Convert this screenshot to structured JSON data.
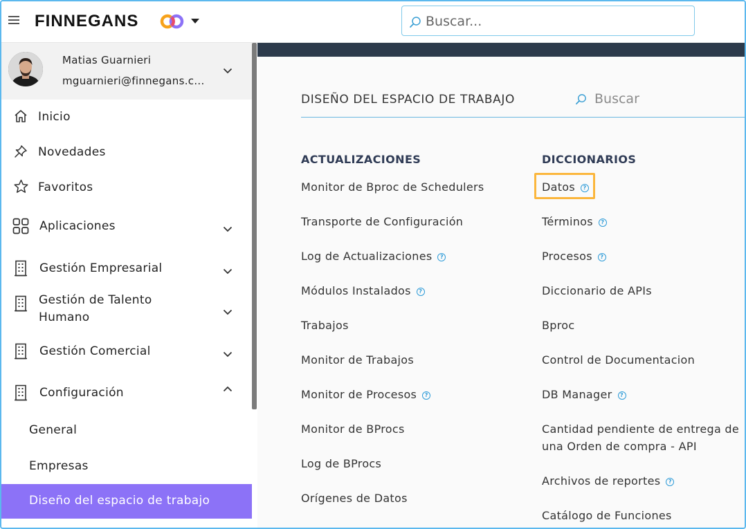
{
  "topbar": {
    "brand": "FINNEGANS",
    "search_placeholder": "Buscar..."
  },
  "profile": {
    "name": "Matias Guarnieri",
    "email": "mguarnieri@finnegans.c..."
  },
  "sidebar": {
    "items": [
      {
        "label": "Inicio",
        "icon": "home-icon"
      },
      {
        "label": "Novedades",
        "icon": "pin-icon"
      },
      {
        "label": "Favoritos",
        "icon": "star-icon"
      },
      {
        "label": "Aplicaciones",
        "icon": "apps-grid-icon"
      },
      {
        "label": "Gestión Empresarial",
        "icon": "building-icon"
      },
      {
        "label": "Gestión de Talento",
        "label2": "Humano",
        "icon": "building-icon"
      },
      {
        "label": "Gestión Comercial",
        "icon": "building-icon"
      },
      {
        "label": "Configuración",
        "icon": "building-icon"
      }
    ],
    "sub_items": [
      "General",
      "Empresas",
      "Diseño del espacio de trabajo"
    ]
  },
  "main": {
    "title": "DISEÑO DEL ESPACIO DE TRABAJO",
    "search_placeholder": "Buscar",
    "columns": [
      {
        "heading": "ACTUALIZACIONES",
        "links": [
          {
            "label": "Monitor de Bproc de Schedulers",
            "help": false
          },
          {
            "label": "Transporte de Configuración",
            "help": false
          },
          {
            "label": "Log de Actualizaciones",
            "help": true
          },
          {
            "label": "Módulos Instalados",
            "help": true
          },
          {
            "label": "Trabajos",
            "help": false
          },
          {
            "label": "Monitor de Trabajos",
            "help": false
          },
          {
            "label": "Monitor de Procesos",
            "help": true
          },
          {
            "label": "Monitor de BProcs",
            "help": false
          },
          {
            "label": "Log de BProcs",
            "help": false
          },
          {
            "label": "Orígenes de Datos",
            "help": false
          }
        ]
      },
      {
        "heading": "DICCIONARIOS",
        "links": [
          {
            "label": "Datos",
            "help": true
          },
          {
            "label": "Términos",
            "help": true
          },
          {
            "label": "Procesos",
            "help": true
          },
          {
            "label": "Diccionario de APIs",
            "help": false
          },
          {
            "label": "Bproc",
            "help": false
          },
          {
            "label": "Control de Documentacion",
            "help": false
          },
          {
            "label": "DB Manager",
            "help": true
          },
          {
            "label": "Cantidad pendiente de entrega de una Orden de compra - API",
            "help": false
          },
          {
            "label": "Archivos de reportes",
            "help": true
          },
          {
            "label": "Catálogo de Funciones",
            "help": false
          }
        ]
      }
    ]
  },
  "colors": {
    "accent_active": "#8c72f7",
    "frame_border": "#5bb8ee",
    "band": "#2c3a4b",
    "highlight": "#fbb63c",
    "help_icon": "#2d9bd8"
  }
}
